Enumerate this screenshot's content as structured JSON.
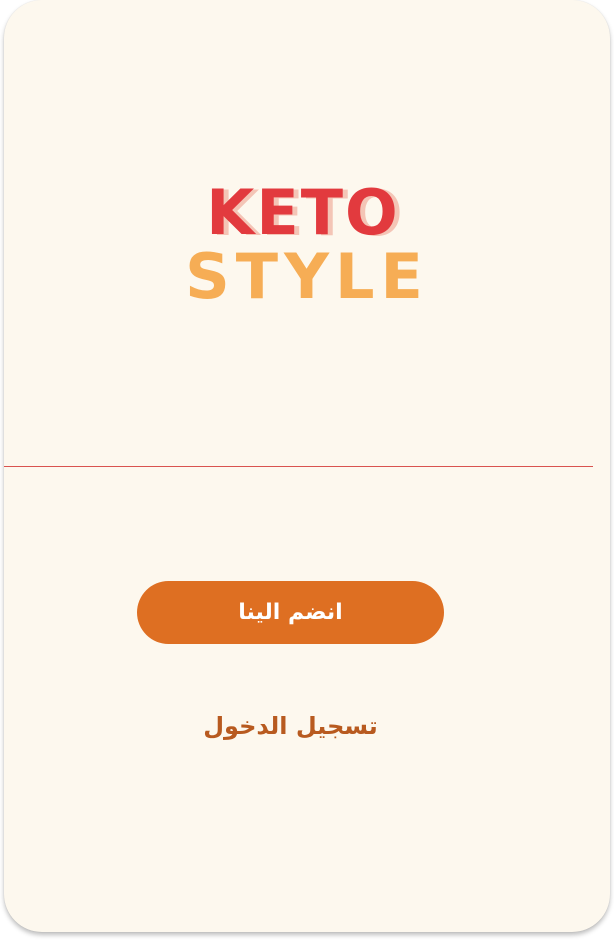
{
  "logo": {
    "line1": "KETO",
    "line2": "STYLE",
    "colors": {
      "line1": "#e23a3e",
      "line1_shadow": "#f4c5b6",
      "line2": "#f6ad55"
    }
  },
  "actions": {
    "join_label": "انضم الينا",
    "login_label": "تسجيل الدخول"
  },
  "theme": {
    "background": "#fdf8ee",
    "accent": "#de6f22",
    "link": "#b85a1f",
    "divider": "#d9534f"
  }
}
